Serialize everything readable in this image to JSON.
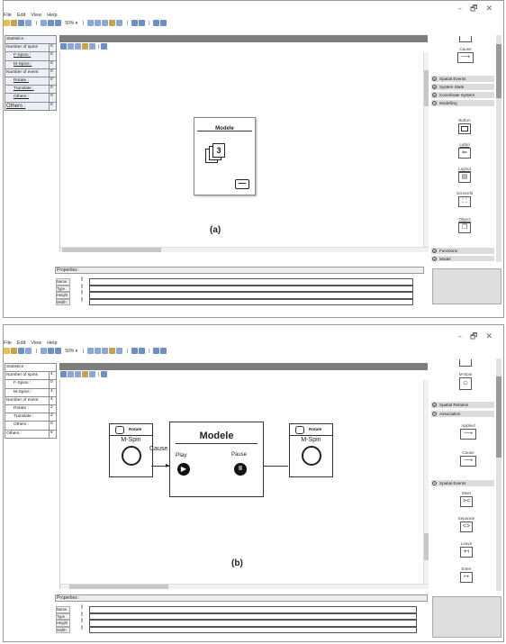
{
  "window_controls": [
    "–",
    "🗗",
    "✕"
  ],
  "menu": [
    "File",
    "Edit",
    "View",
    "Help"
  ],
  "toolbar": {
    "zoom_label": "50% ▾"
  },
  "panel_a": {
    "caption": "(a)",
    "stats": [
      {
        "label": "Statistics :",
        "value": "",
        "indent": false
      },
      {
        "label": "Number of spins",
        "value": "0",
        "indent": false
      },
      {
        "label": "F-Spins :",
        "value": "0",
        "indent": true
      },
      {
        "label": "M-Spins :",
        "value": "0",
        "indent": true
      },
      {
        "label": "Number of event",
        "value": "0",
        "indent": false
      },
      {
        "label": "Rotate :",
        "value": "0",
        "indent": true
      },
      {
        "label": "Translate :",
        "value": "0",
        "indent": true
      },
      {
        "label": "Others :",
        "value": "0",
        "indent": true
      },
      {
        "label": "Others :",
        "value": "0",
        "indent": false
      }
    ],
    "module_title": "Modele",
    "module_icon_number": "3",
    "properties_label": "Properties :",
    "property_rows": [
      "Name :",
      "Type :",
      "Height :",
      "Width :"
    ],
    "palette_top_label": "Cause",
    "sections": [
      "Spatial Events",
      "System State",
      "Coordinate System",
      "Modelling",
      "Functions",
      "Model"
    ],
    "tools": [
      "Button",
      "Label",
      "Layout",
      "Screenfit",
      "Object"
    ]
  },
  "panel_b": {
    "caption": "(b)",
    "stats": [
      {
        "label": "Statistics :",
        "value": "",
        "indent": false
      },
      {
        "label": "Number of spins",
        "value": "4",
        "indent": false
      },
      {
        "label": "F-Spins :",
        "value": "0",
        "indent": true
      },
      {
        "label": "M-Spins :",
        "value": "4",
        "indent": true
      },
      {
        "label": "Number of event",
        "value": "4",
        "indent": false
      },
      {
        "label": "Rotate :",
        "value": "2",
        "indent": true
      },
      {
        "label": "Translate :",
        "value": "2",
        "indent": true
      },
      {
        "label": "Others :",
        "value": "0",
        "indent": true
      },
      {
        "label": "Others :",
        "value": "6",
        "indent": false
      }
    ],
    "module_title": "Modele",
    "play_label": "Play",
    "pause_label": "Pause",
    "cause_label": "Cause",
    "left_spin": {
      "header": "Rotate",
      "name": "M-Spin"
    },
    "right_spin": {
      "header": "Rotate",
      "name": "M-Spin"
    },
    "properties_label": "Properties :",
    "property_rows": [
      "Name :",
      "Type :",
      "Height :",
      "Width :"
    ],
    "palette_top_label": "M-Spin",
    "sections": [
      "Spatial Relation",
      "Association",
      "Spatial Events"
    ],
    "assoc_tools": [
      "Applied",
      "Cause"
    ],
    "event_tools": [
      "Meet",
      "Separate",
      "Leave",
      "Enter"
    ]
  }
}
